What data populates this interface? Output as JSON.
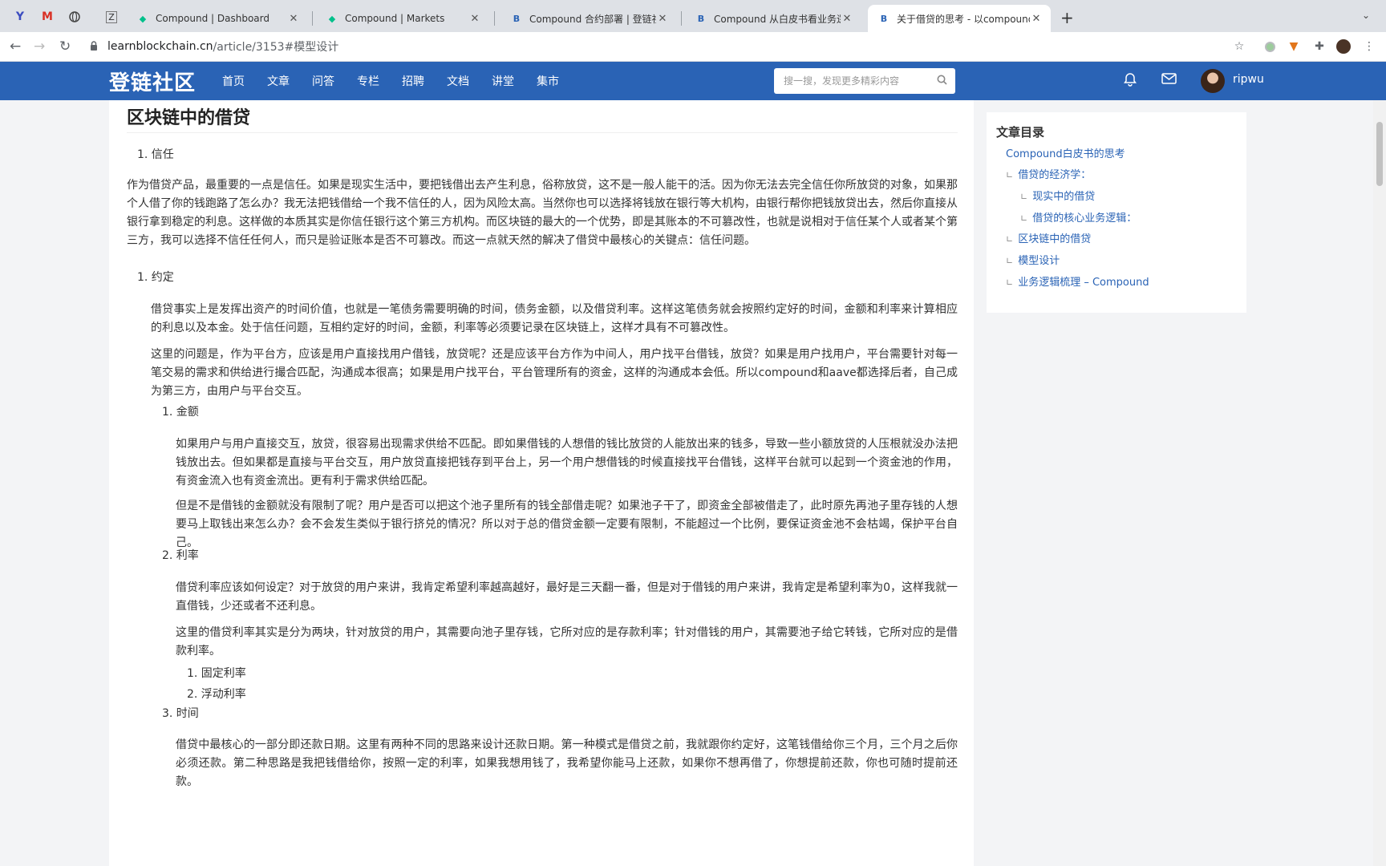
{
  "browser": {
    "tabs": [
      {
        "title": "Compound | Dashboard",
        "favicon": "leaf-icon"
      },
      {
        "title": "Compound | Markets",
        "favicon": "leaf-icon"
      },
      {
        "title": "Compound 合约部署 | 登链社区",
        "favicon": "learnblockchain-icon"
      },
      {
        "title": "Compound 从白皮书看业务逻辑",
        "favicon": "learnblockchain-icon"
      },
      {
        "title": "关于借贷的思考 - 以compound",
        "favicon": "learnblockchain-icon"
      }
    ],
    "url_host": "learnblockchain.cn",
    "url_path": "/article/3153#模型设计"
  },
  "site": {
    "logo": "登链社区",
    "nav": [
      "首页",
      "文章",
      "问答",
      "专栏",
      "招聘",
      "文档",
      "讲堂",
      "集市"
    ],
    "search_placeholder": "搜一搜，发现更多精彩内容",
    "username": "ripwu"
  },
  "article": {
    "heading": "区块链中的借贷",
    "trust_label": "1. 信任",
    "trust_para": "作为借贷产品，最重要的一点是信任。如果是现实生活中，要把钱借出去产生利息，俗称放贷，这不是一般人能干的活。因为你无法去完全信任你所放贷的对象，如果那个人借了你的钱跑路了怎么办？我无法把钱借给一个我不信任的人，因为风险太高。当然你也可以选择将钱放在银行等大机构，由银行帮你把钱放贷出去，然后你直接从银行拿到稳定的利息。这样做的本质其实是你信任银行这个第三方机构。而区块链的最大的一个优势，即是其账本的不可篡改性，也就是说相对于信任某个人或者某个第三方，我可以选择不信任任何人，而只是验证账本是否不可篡改。而这一点就天然的解决了借贷中最核心的关键点：信任问题。",
    "agreement_label": "1. 约定",
    "agreement_para1": "借贷事实上是发挥出资产的时间价值，也就是一笔债务需要明确的时间，债务金额，以及借贷利率。这样这笔债务就会按照约定好的时间，金额和利率来计算相应的利息以及本金。处于信任问题，互相约定好的时间，金额，利率等必须要记录在区块链上，这样才具有不可篡改性。",
    "agreement_para2": "这里的问题是，作为平台方，应该是用户直接找用户借钱，放贷呢？还是应该平台方作为中间人，用户找平台借钱，放贷？如果是用户找用户，平台需要针对每一笔交易的需求和供给进行撮合匹配，沟通成本很高；如果是用户找平台，平台管理所有的资金，这样的沟通成本会低。所以compound和aave都选择后者，自己成为第三方，由用户与平台交互。",
    "amount_label": "1. 金额",
    "amount_para1": "如果用户与用户直接交互，放贷，很容易出现需求供给不匹配。即如果借钱的人想借的钱比放贷的人能放出来的钱多，导致一些小额放贷的人压根就没办法把钱放出去。但如果都是直接与平台交互，用户放贷直接把钱存到平台上，另一个用户想借钱的时候直接找平台借钱，这样平台就可以起到一个资金池的作用，有资金流入也有资金流出。更有利于需求供给匹配。",
    "amount_para2": "但是不是借钱的金额就没有限制了呢？用户是否可以把这个池子里所有的钱全部借走呢？如果池子干了，即资金全部被借走了，此时原先再池子里存钱的人想要马上取钱出来怎么办？会不会发生类似于银行挤兑的情况？所以对于总的借贷金额一定要有限制，不能超过一个比例，要保证资金池不会枯竭，保护平台自己。",
    "rate_label": "2. 利率",
    "rate_para1": "借贷利率应该如何设定？对于放贷的用户来讲，我肯定希望利率越高越好，最好是三天翻一番，但是对于借钱的用户来讲，我肯定是希望利率为0，这样我就一直借钱，少还或者不还利息。",
    "rate_para2": "这里的借贷利率其实是分为两块，针对放贷的用户，其需要向池子里存钱，它所对应的是存款利率；针对借钱的用户，其需要池子给它转钱，它所对应的是借款利率。",
    "rate_fixed": "1. 固定利率",
    "rate_float": "2. 浮动利率",
    "time_label": "3. 时间",
    "time_para1": "借贷中最核心的一部分即还款日期。这里有两种不同的思路来设计还款日期。第一种模式是借贷之前，我就跟你约定好，这笔钱借给你三个月，三个月之后你必须还款。第二种思路是我把钱借给你，按照一定的利率，如果我想用钱了，我希望你能马上还款，如果你不想再借了，你想提前还款，你也可随时提前还款。"
  },
  "toc": {
    "title": "文章目录",
    "items": [
      {
        "label": "Compound白皮书的思考"
      },
      {
        "label": "借贷的经济学："
      },
      {
        "label": "现实中的借贷"
      },
      {
        "label": "借贷的核心业务逻辑："
      },
      {
        "label": "区块链中的借贷"
      },
      {
        "label": "模型设计"
      },
      {
        "label": "业务逻辑梳理 – Compound"
      }
    ]
  },
  "colors": {
    "header": "#2a63b5",
    "link": "#2a63b5"
  }
}
